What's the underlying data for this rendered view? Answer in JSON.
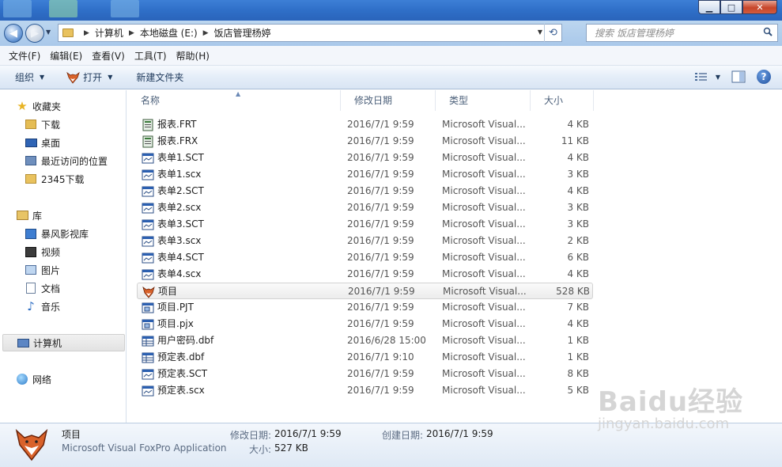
{
  "window": {
    "minimize": "▁",
    "maximize": "□",
    "close": "✕"
  },
  "address": {
    "crumbs": [
      "计算机",
      "本地磁盘 (E:)",
      "饭店管理杨婷"
    ],
    "search_placeholder": "搜索 饭店管理杨婷"
  },
  "menu": [
    "文件(F)",
    "编辑(E)",
    "查看(V)",
    "工具(T)",
    "帮助(H)"
  ],
  "toolbar": {
    "organize": "组织",
    "open": "打开",
    "new_folder": "新建文件夹"
  },
  "sidebar": {
    "favorites": {
      "label": "收藏夹",
      "items": [
        "下载",
        "桌面",
        "最近访问的位置",
        "2345下载"
      ]
    },
    "libraries": {
      "label": "库",
      "items": [
        "暴风影视库",
        "视频",
        "图片",
        "文档",
        "音乐"
      ]
    },
    "computer": "计算机",
    "network": "网络"
  },
  "columns": {
    "name": "名称",
    "date": "修改日期",
    "type": "类型",
    "size": "大小"
  },
  "files": [
    {
      "name": "报表.FRT",
      "date": "2016/7/1 9:59",
      "type": "Microsoft Visual...",
      "size": "4 KB",
      "icon": "report-icon"
    },
    {
      "name": "报表.FRX",
      "date": "2016/7/1 9:59",
      "type": "Microsoft Visual...",
      "size": "11 KB",
      "icon": "report-icon"
    },
    {
      "name": "表单1.SCT",
      "date": "2016/7/1 9:59",
      "type": "Microsoft Visual...",
      "size": "4 KB",
      "icon": "form-icon"
    },
    {
      "name": "表单1.scx",
      "date": "2016/7/1 9:59",
      "type": "Microsoft Visual...",
      "size": "3 KB",
      "icon": "form-icon"
    },
    {
      "name": "表单2.SCT",
      "date": "2016/7/1 9:59",
      "type": "Microsoft Visual...",
      "size": "4 KB",
      "icon": "form-icon"
    },
    {
      "name": "表单2.scx",
      "date": "2016/7/1 9:59",
      "type": "Microsoft Visual...",
      "size": "3 KB",
      "icon": "form-icon"
    },
    {
      "name": "表单3.SCT",
      "date": "2016/7/1 9:59",
      "type": "Microsoft Visual...",
      "size": "3 KB",
      "icon": "form-icon"
    },
    {
      "name": "表单3.scx",
      "date": "2016/7/1 9:59",
      "type": "Microsoft Visual...",
      "size": "2 KB",
      "icon": "form-icon"
    },
    {
      "name": "表单4.SCT",
      "date": "2016/7/1 9:59",
      "type": "Microsoft Visual...",
      "size": "6 KB",
      "icon": "form-icon"
    },
    {
      "name": "表单4.scx",
      "date": "2016/7/1 9:59",
      "type": "Microsoft Visual...",
      "size": "4 KB",
      "icon": "form-icon"
    },
    {
      "name": "项目",
      "date": "2016/7/1 9:59",
      "type": "Microsoft Visual...",
      "size": "528 KB",
      "icon": "foxpro-app-icon",
      "selected": true
    },
    {
      "name": "项目.PJT",
      "date": "2016/7/1 9:59",
      "type": "Microsoft Visual...",
      "size": "7 KB",
      "icon": "project-icon"
    },
    {
      "name": "项目.pjx",
      "date": "2016/7/1 9:59",
      "type": "Microsoft Visual...",
      "size": "4 KB",
      "icon": "project-icon"
    },
    {
      "name": "用户密码.dbf",
      "date": "2016/6/28 15:00",
      "type": "Microsoft Visual...",
      "size": "1 KB",
      "icon": "table-icon"
    },
    {
      "name": "预定表.dbf",
      "date": "2016/7/1 9:10",
      "type": "Microsoft Visual...",
      "size": "1 KB",
      "icon": "table-icon"
    },
    {
      "name": "预定表.SCT",
      "date": "2016/7/1 9:59",
      "type": "Microsoft Visual...",
      "size": "8 KB",
      "icon": "form-icon"
    },
    {
      "name": "预定表.scx",
      "date": "2016/7/1 9:59",
      "type": "Microsoft Visual...",
      "size": "5 KB",
      "icon": "form-icon"
    }
  ],
  "details": {
    "name": "项目",
    "type": "Microsoft Visual FoxPro Application",
    "modified_label": "修改日期:",
    "modified_value": "2016/7/1 9:59",
    "size_label": "大小:",
    "size_value": "527 KB",
    "created_label": "创建日期:",
    "created_value": "2016/7/1 9:59"
  },
  "watermark": {
    "brand": "Baidu经验",
    "url": "jingyan.baidu.com"
  }
}
